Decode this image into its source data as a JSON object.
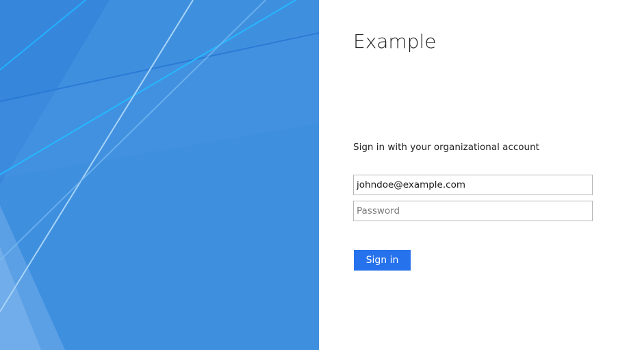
{
  "brand": {
    "name": "Example"
  },
  "signin": {
    "intro_text": "Sign in with your organizational account",
    "username_value": "johndoe@example.com",
    "password_placeholder": "Password",
    "submit_label": "Sign in"
  },
  "colors": {
    "illustration_background": "#3f8fdf",
    "button_background": "#2672ec",
    "button_text": "#ffffff",
    "field_border": "#b7b7b7"
  }
}
